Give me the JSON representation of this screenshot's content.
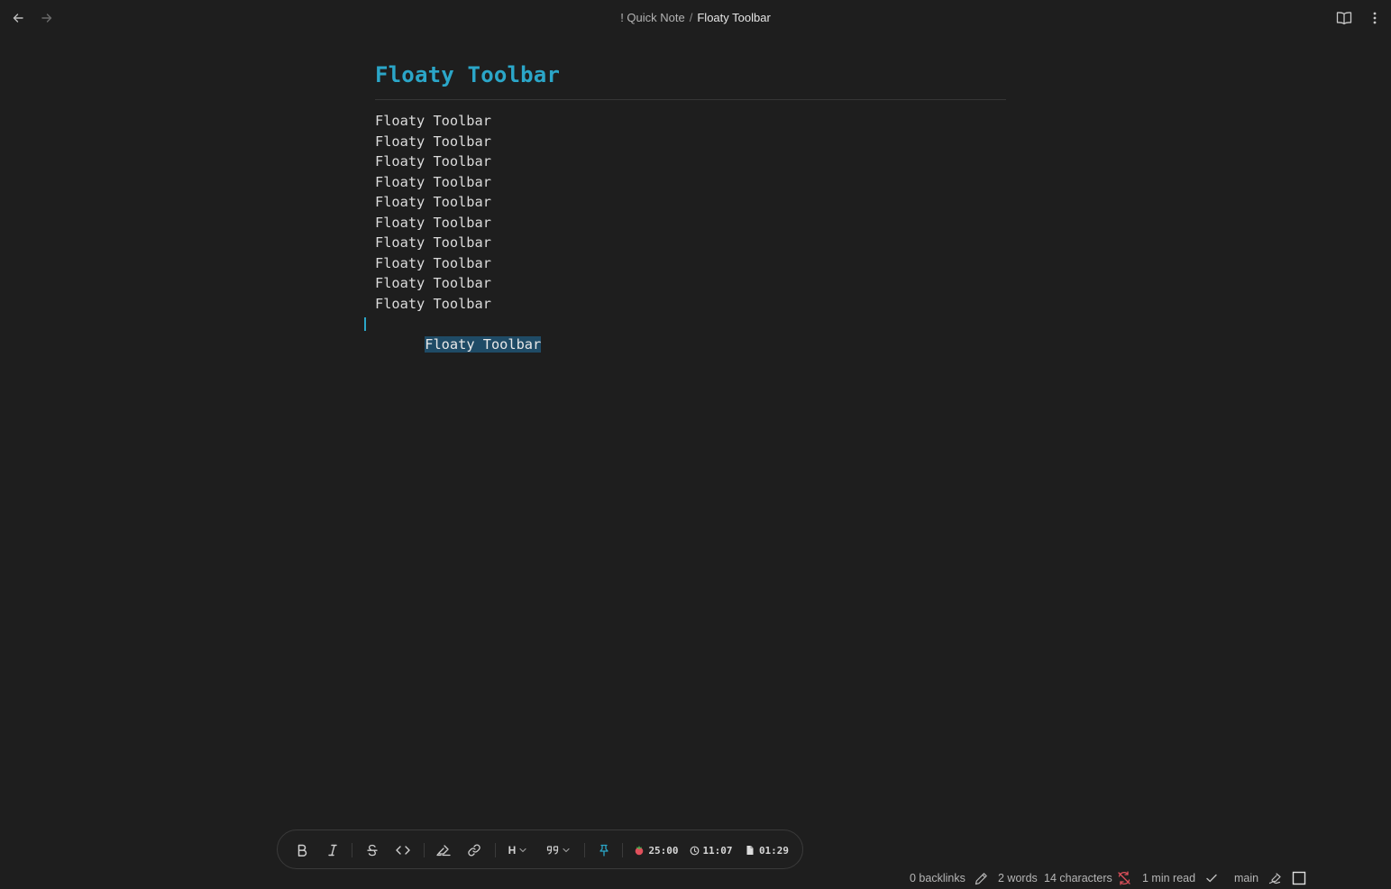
{
  "header": {
    "breadcrumb_parent": "! Quick Note",
    "breadcrumb_separator": "/",
    "breadcrumb_current": "Floaty Toolbar",
    "icons": [
      "arrow-left-icon",
      "arrow-right-icon",
      "book-open-icon",
      "more-vertical-icon"
    ]
  },
  "editor": {
    "title": "Floaty Toolbar",
    "lines": [
      "Floaty Toolbar",
      "Floaty Toolbar",
      "Floaty Toolbar",
      "Floaty Toolbar",
      "Floaty Toolbar",
      "Floaty Toolbar",
      "Floaty Toolbar",
      "Floaty Toolbar",
      "Floaty Toolbar",
      "Floaty Toolbar",
      "Floaty Toolbar"
    ],
    "selected_line": 11
  },
  "toolbar": {
    "heading_label": "H",
    "pomodoro": "25:00",
    "clock": "11:07",
    "doc_timer": "01:29",
    "icons": [
      "bold-icon",
      "italic-icon",
      "strikethrough-icon",
      "code-icon",
      "highlighter-icon",
      "link-icon",
      "heading-icon",
      "quote-icon",
      "pin-icon",
      "tomato-icon",
      "clock-icon",
      "document-icon"
    ]
  },
  "statusbar": {
    "backlinks": "0 backlinks",
    "words": "2 words",
    "characters": "14 characters",
    "read_time": "1 min read",
    "branch": "main"
  },
  "colors": {
    "background": "#1e1e1e",
    "accent": "#2ba6c8",
    "selection": "#1f4b66",
    "sync_error": "#e0505b"
  }
}
